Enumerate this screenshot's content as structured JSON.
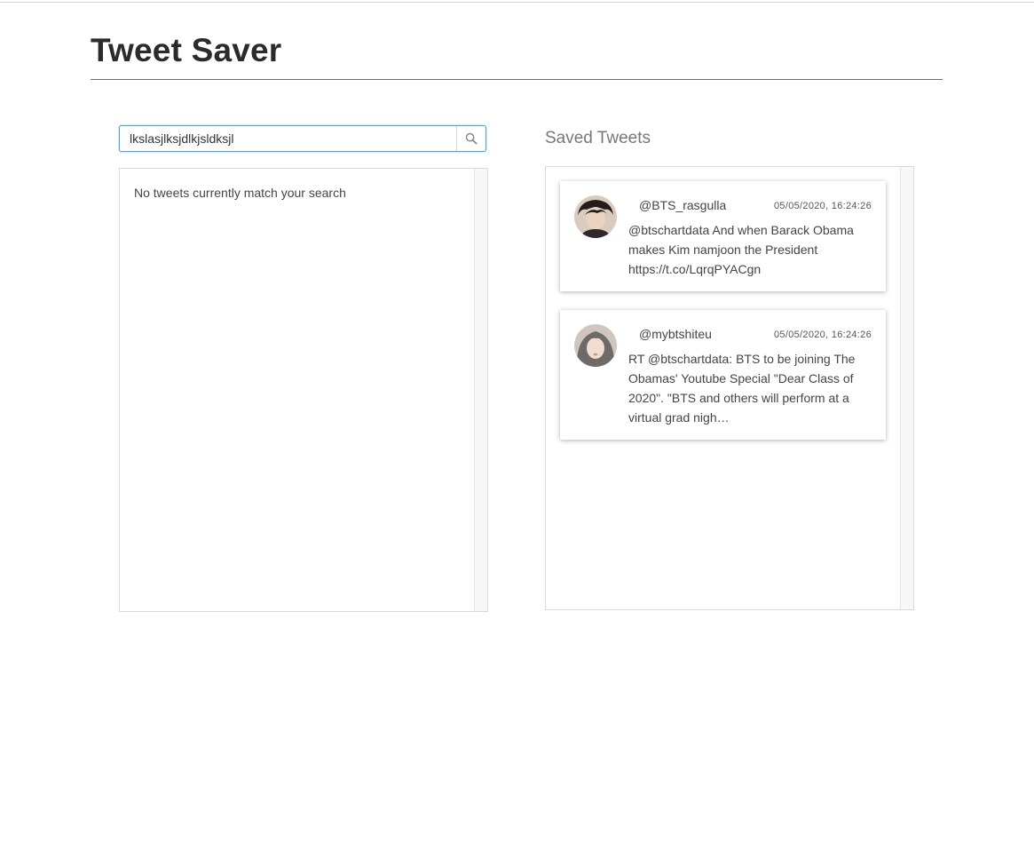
{
  "app": {
    "title": "Tweet Saver"
  },
  "search": {
    "value": "lkslasjlksjdlkjsldksjl",
    "button_icon": "search-icon"
  },
  "results": {
    "empty_message": "No tweets currently match your search"
  },
  "saved": {
    "heading": "Saved Tweets",
    "tweets": [
      {
        "handle": "@BTS_rasgulla",
        "timestamp": "05/05/2020, 16:24:26",
        "text": "@btschartdata And when Barack Obama makes Kim namjoon the President https://t.co/LqrqPYACgn",
        "avatar_icon": "avatar"
      },
      {
        "handle": "@mybtshiteu",
        "timestamp": "05/05/2020, 16:24:26",
        "text": "RT @btschartdata: BTS to be joining The Obamas' Youtube Special \"Dear Class of 2020\". \"BTS and others will perform at a virtual grad nigh…",
        "avatar_icon": "avatar"
      }
    ]
  },
  "colors": {
    "focus_border": "#4fa7d9",
    "spellcheck_underline": "#e0453a",
    "heading_muted": "#777777"
  }
}
